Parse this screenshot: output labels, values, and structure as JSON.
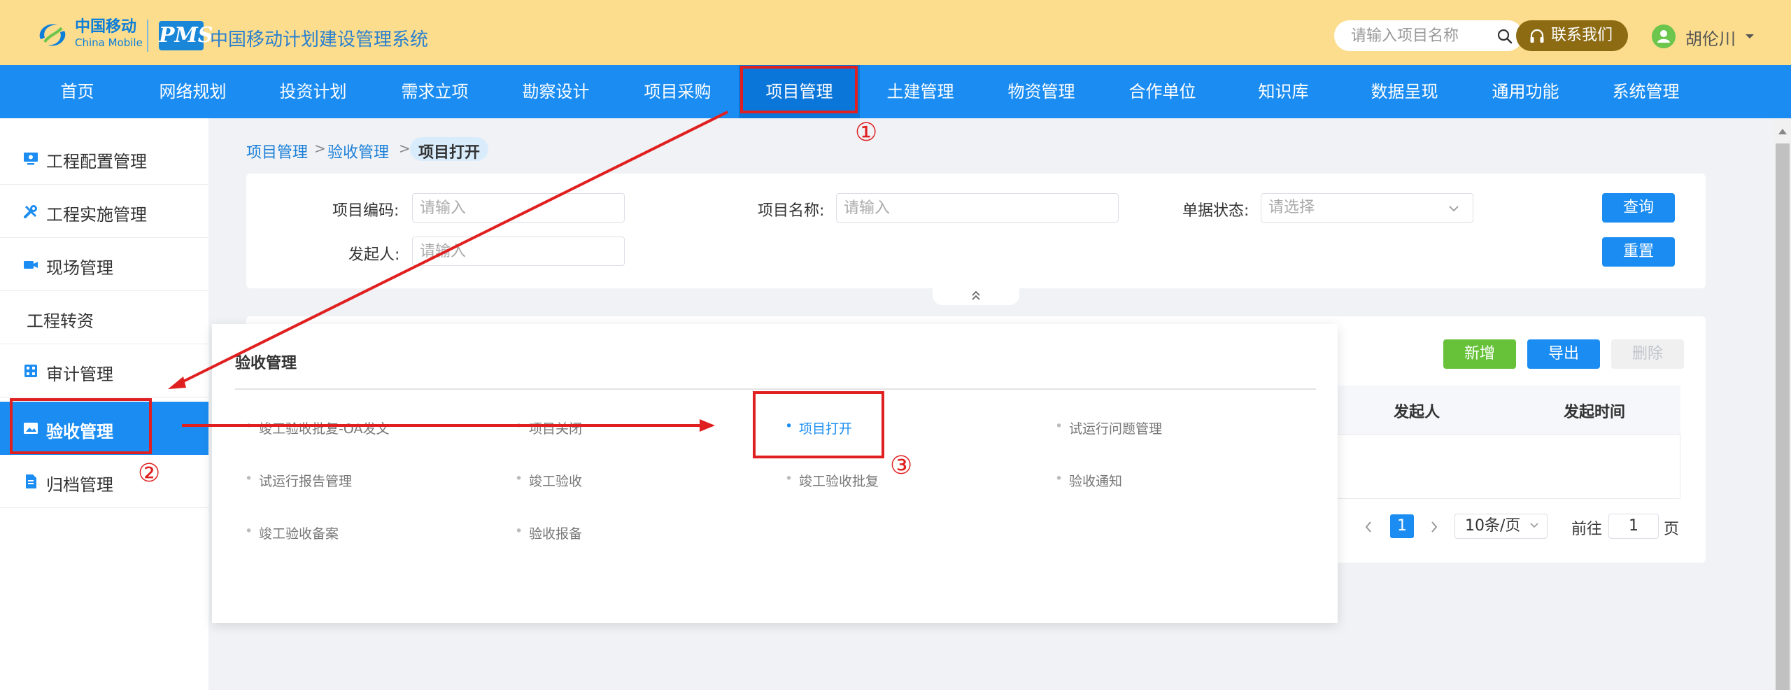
{
  "header": {
    "brand_cn": "中国移动",
    "brand_en": "China Mobile",
    "pms_logo": "PMS",
    "system_title": "中国移动计划建设管理系统",
    "search_placeholder": "请输入项目名称",
    "contact_label": "联系我们",
    "user_name": "胡伦川",
    "icons": [
      "search-icon",
      "headset-icon",
      "user-avatar-icon",
      "caret-down-icon"
    ]
  },
  "nav": {
    "items": [
      "首页",
      "网络规划",
      "投资计划",
      "需求立项",
      "勘察设计",
      "项目采购",
      "项目管理",
      "土建管理",
      "物资管理",
      "合作单位",
      "知识库",
      "数据呈现",
      "通用功能",
      "系统管理"
    ],
    "active": "项目管理"
  },
  "sidebar": {
    "items": [
      "工程配置管理",
      "工程实施管理",
      "现场管理",
      "工程转资",
      "审计管理",
      "验收管理",
      "归档管理"
    ],
    "active": "验收管理"
  },
  "breadcrumb": {
    "items": [
      "项目管理",
      "验收管理"
    ],
    "current": "项目打开"
  },
  "filter": {
    "project_code_label": "项目编码:",
    "project_code_placeholder": "请输入",
    "project_name_label": "项目名称:",
    "project_name_placeholder": "请输入",
    "status_label": "单据状态:",
    "status_placeholder": "请选择",
    "initiator_label": "发起人:",
    "initiator_placeholder": "请输入",
    "query_button": "查询",
    "reset_button": "重置"
  },
  "toolbar": {
    "add_button": "新增",
    "export_button": "导出",
    "delete_button": "删除"
  },
  "table": {
    "columns": [
      "发起人",
      "发起时间"
    ],
    "rows": []
  },
  "pagination": {
    "current_page": "1",
    "page_size": "10条/页",
    "goto_label": "前往",
    "goto_value": "1",
    "page_unit": "页"
  },
  "dropdown_panel": {
    "title": "验收管理",
    "links": [
      "竣工验收批复-OA发文",
      "项目关闭",
      "项目打开",
      "试运行问题管理",
      "试运行报告管理",
      "竣工验收",
      "竣工验收批复",
      "验收通知",
      "竣工验收备案",
      "验收报备"
    ],
    "selected": "项目打开"
  },
  "annotations": {
    "step1": "①",
    "step2": "②",
    "step3": "③",
    "color": "#e02020"
  },
  "colors": {
    "header_bg": "#fcdd8d",
    "nav_bg": "#1b8df2",
    "primary": "#1b8df2",
    "success": "#67c23a",
    "contact_bg": "#8c6b13"
  }
}
